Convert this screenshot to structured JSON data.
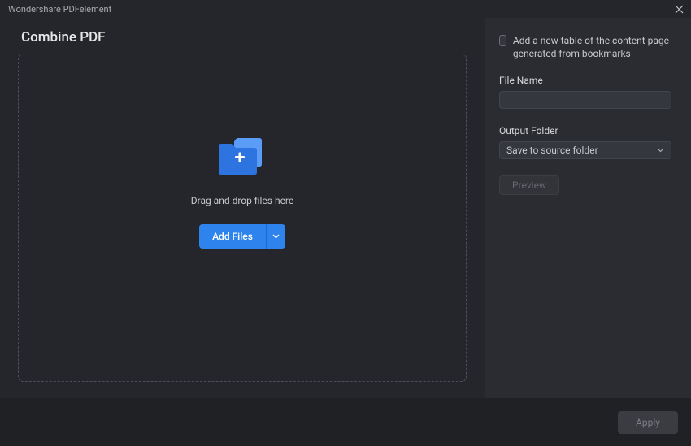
{
  "titlebar": {
    "app_name": "Wondershare PDFelement"
  },
  "page_title": "Combine PDF",
  "dropzone": {
    "instruction": "Drag and drop files here",
    "add_files_label": "Add Files"
  },
  "sidebar": {
    "checkbox_label": "Add a new table of the content page generated from bookmarks",
    "file_name_label": "File Name",
    "file_name_value": "",
    "output_folder_label": "Output Folder",
    "output_folder_value": "Save to source folder",
    "preview_label": "Preview"
  },
  "footer": {
    "apply_label": "Apply"
  }
}
